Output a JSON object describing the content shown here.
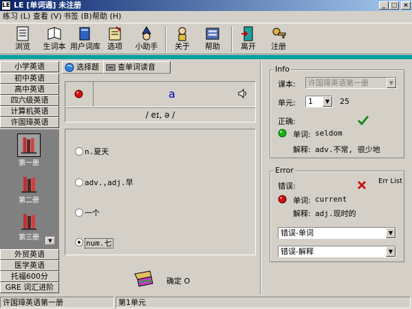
{
  "window": {
    "title": "LE [单词通] 未注册",
    "icon_text": "LE",
    "buttons": [
      "_",
      "□",
      "×"
    ]
  },
  "menu": [
    {
      "label": "练习 (L)"
    },
    {
      "label": "查看 (V)"
    },
    {
      "label": "书签 (B)"
    },
    {
      "label": "帮助 (H)"
    }
  ],
  "toolbar": [
    {
      "label": "浏览",
      "icon": "book-browse-icon"
    },
    {
      "label": "生词本",
      "icon": "notebook-icon"
    },
    {
      "label": "用户词库",
      "icon": "user-library-icon"
    },
    {
      "label": "选项",
      "icon": "options-icon"
    },
    {
      "label": "小助手",
      "icon": "assistant-icon"
    },
    {
      "label": "关于",
      "icon": "about-icon"
    },
    {
      "label": "帮助",
      "icon": "help-icon"
    },
    {
      "label": "离开",
      "icon": "exit-door-icon"
    },
    {
      "label": "注册",
      "icon": "register-key-icon"
    }
  ],
  "nav": {
    "top": [
      "小学英语",
      "初中英语",
      "高中英语",
      "四六级英语",
      "计算机英语",
      "许国璋英语"
    ],
    "books": [
      "第一册",
      "第二册",
      "第三册"
    ],
    "bottom": [
      "外贸英语",
      "医学英语",
      "托福600分",
      "GRE 词汇进阶"
    ]
  },
  "tabs": [
    {
      "label": "选择题"
    },
    {
      "label": "查单词读音"
    }
  ],
  "question": {
    "word": "a",
    "phonetic": "/ eɪ, ə /"
  },
  "options": [
    {
      "text": "n.夏天",
      "selected": false
    },
    {
      "text": "adv.,adj.早",
      "selected": false
    },
    {
      "text": "一个",
      "selected": false
    },
    {
      "text": "num.七",
      "selected": true
    }
  ],
  "confirm": {
    "label": "确定 O"
  },
  "info": {
    "title": "Info",
    "textbook_label": "课本:",
    "textbook_value": "许国璋英语第一册",
    "unit_label": "单元:",
    "unit_value": "1",
    "unit_total": "25",
    "correct_label": "正确:",
    "word_label": "单词:",
    "word_value": "seldom",
    "meaning_label": "解释:",
    "meaning_value": "adv.不常, 很少地"
  },
  "error": {
    "title": "Error",
    "list_label": "Err List",
    "label": "错误:",
    "word_label": "单词:",
    "word_value": "current",
    "meaning_label": "解释:",
    "meaning_value": "adj.现时的",
    "select1": "错误-单词",
    "select2": "错误-解释"
  },
  "status": {
    "book": "许国璋英语第一册",
    "unit": "第1单元"
  },
  "colors": {
    "teal": "#00a0a0",
    "accent_blue": "#0000cc",
    "correct_green": "#1a8a1a",
    "error_red": "#cc1111"
  }
}
